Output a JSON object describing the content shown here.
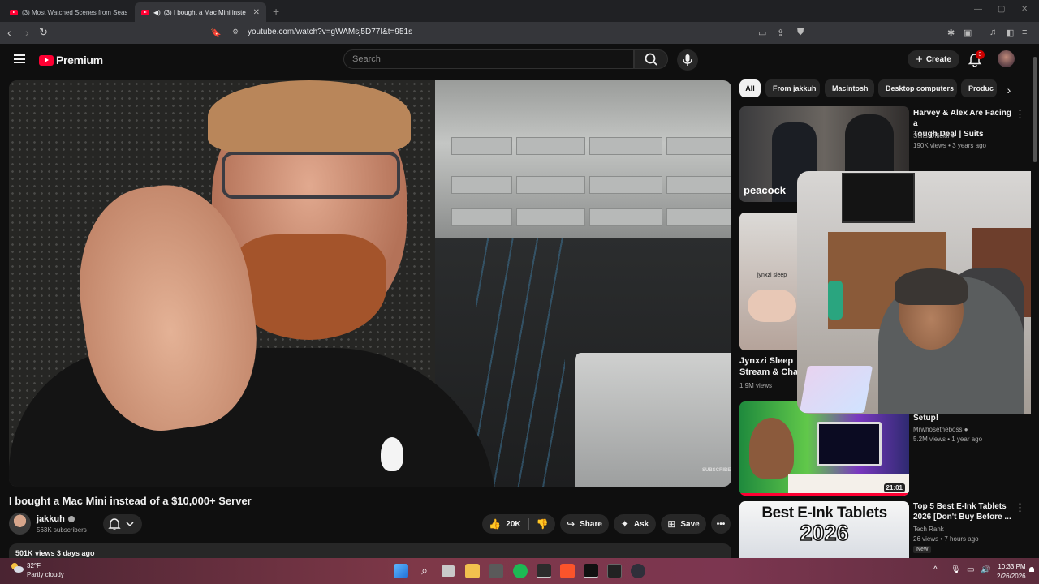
{
  "browser": {
    "tabs": [
      {
        "label": "(3) Most Watched Scenes from Seas"
      },
      {
        "label": "(3) I bought a Mac Mini inste"
      }
    ],
    "url": "youtube.com/watch?v=gWAMsj5D77I&t=951s"
  },
  "header": {
    "brand": "Premium",
    "search_placeholder": "Search",
    "create_label": "Create",
    "notification_count": "3"
  },
  "video": {
    "title": "I bought a Mac Mini instead of a $10,000+ Server",
    "overlay_text": "SUBSCRIBE",
    "channel": {
      "name": "jakkuh",
      "subscribers": "563K subscribers"
    },
    "like_count": "20K",
    "actions": {
      "share": "Share",
      "ask": "Ask",
      "save": "Save"
    },
    "views_line": "501K views  3 days ago"
  },
  "chips": [
    "All",
    "From jakkuh",
    "Macintosh",
    "Desktop computers",
    "Produc"
  ],
  "recommendations": [
    {
      "title_lines": [
        "Harvey & Alex Are Facing a",
        "Tough Deal | Suits"
      ],
      "channel": "Suits Official",
      "meta": "190K views • 3 years ago",
      "thumb_text": "peacock"
    },
    {
      "title_lines": [
        "Jynxzi Sleep",
        "Stream & Chat"
      ],
      "meta": "1.9M views",
      "thumb_text": "jynxzi sleep"
    },
    {
      "title_lines": [
        "Setup!"
      ],
      "channel": "Mrwhosetheboss",
      "meta": "5.2M views • 1 year ago",
      "duration": "21:01"
    },
    {
      "title_lines": [
        "Top 5 Best E-Ink Tablets",
        "2026 [Don't Buy Before ..."
      ],
      "channel": "Tech Rank",
      "meta": "26 views • 7 hours ago",
      "badge": "New",
      "thumb_lines": [
        "Best E-Ink Tablets",
        "2026"
      ]
    }
  ],
  "taskbar": {
    "temperature": "32°F",
    "weather": "Partly cloudy",
    "time": "10:33 PM",
    "date": "2/26/2026"
  },
  "colors": {
    "brand_red": "#ff0033",
    "background": "#0f0f0f",
    "pill": "#272727"
  }
}
